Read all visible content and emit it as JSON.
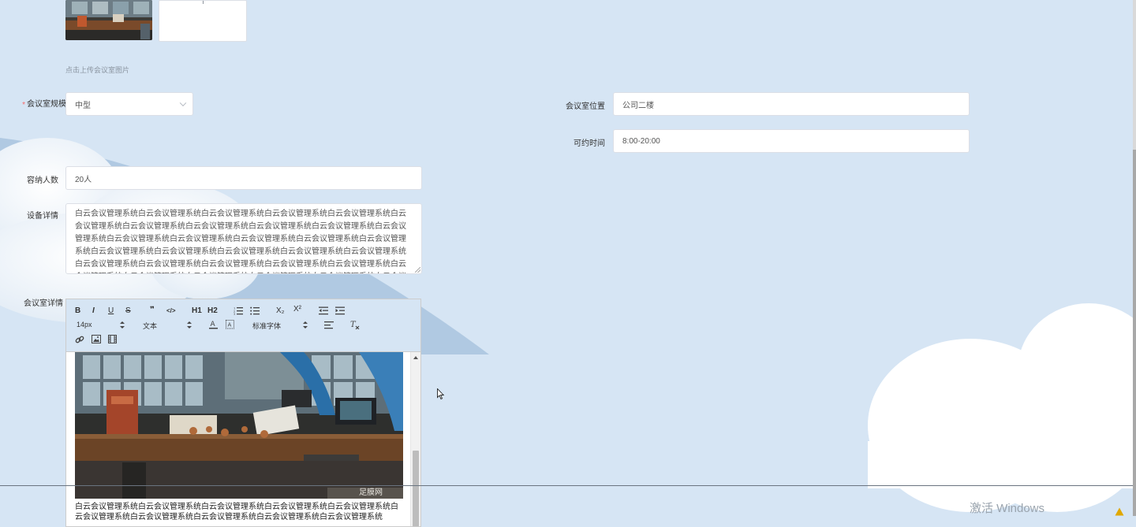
{
  "upload": {
    "hint": "点击上传会议室图片"
  },
  "form": {
    "scale": {
      "label": "会议室规模",
      "value": "中型",
      "required": true
    },
    "location": {
      "label": "会议室位置",
      "value": "公司二楼"
    },
    "available_time": {
      "label": "可约时间",
      "value": "8:00-20:00"
    },
    "capacity": {
      "label": "容纳人数",
      "value": "20人"
    },
    "equipment": {
      "label": "设备详情",
      "value": "白云会议管理系统白云会议管理系统白云会议管理系统白云会议管理系统白云会议管理系统白云会议管理系统白云会议管理系统白云会议管理系统白云会议管理系统白云会议管理系统白云会议管理系统白云会议管理系统白云会议管理系统白云会议管理系统白云会议管理系统白云会议管理系统白云会议管理系统白云会议管理系统白云会议管理系统白云会议管理系统白云会议管理系统白云会议管理系统白云会议管理系统白云会议管理系统白云会议管理系统白云会议管理系统白云会议管理系统白云会议管理系统白云会议管理系统白云会议管理系统白云会议管理系统白云会议管理系统白云会议管理系统白云会议管理系统白云会议管理系统白云会议管理系统白云会议管理系统白云会议管理系统白云会议管理系统白云会议管理系统白云会议管理系统白云会议管理系统白云会议管理系统白云会议管理系统白云会议管理系统白云会议管理系统白云会议管理系统白云会议管理系统白云会议管理系统白云会议管理系统"
    },
    "details": {
      "label": "会议室详情"
    }
  },
  "editor": {
    "toolbar": {
      "bold": "B",
      "italic": "I",
      "underline": "U",
      "strike": "S",
      "quote": "❞",
      "code": "</>",
      "h1": "H1",
      "h2": "H2",
      "subscript": "X₂",
      "superscript": "X²",
      "font_size": "14px",
      "text_type": "文本",
      "font_family": "标准字体"
    },
    "content_text": "白云会议管理系统白云会议管理系统白云会议管理系统白云会议管理系统白云会议管理系统白云会议管理系统白云会议管理系统白云会议管理系统白云会议管理系统白云会议管理系统",
    "image_watermark": "足膜网"
  },
  "os": {
    "watermark": "激活 Windows"
  },
  "colors": {
    "background": "#d6e5f4",
    "required": "#f56c6c",
    "input_border": "#dcdfe6"
  }
}
